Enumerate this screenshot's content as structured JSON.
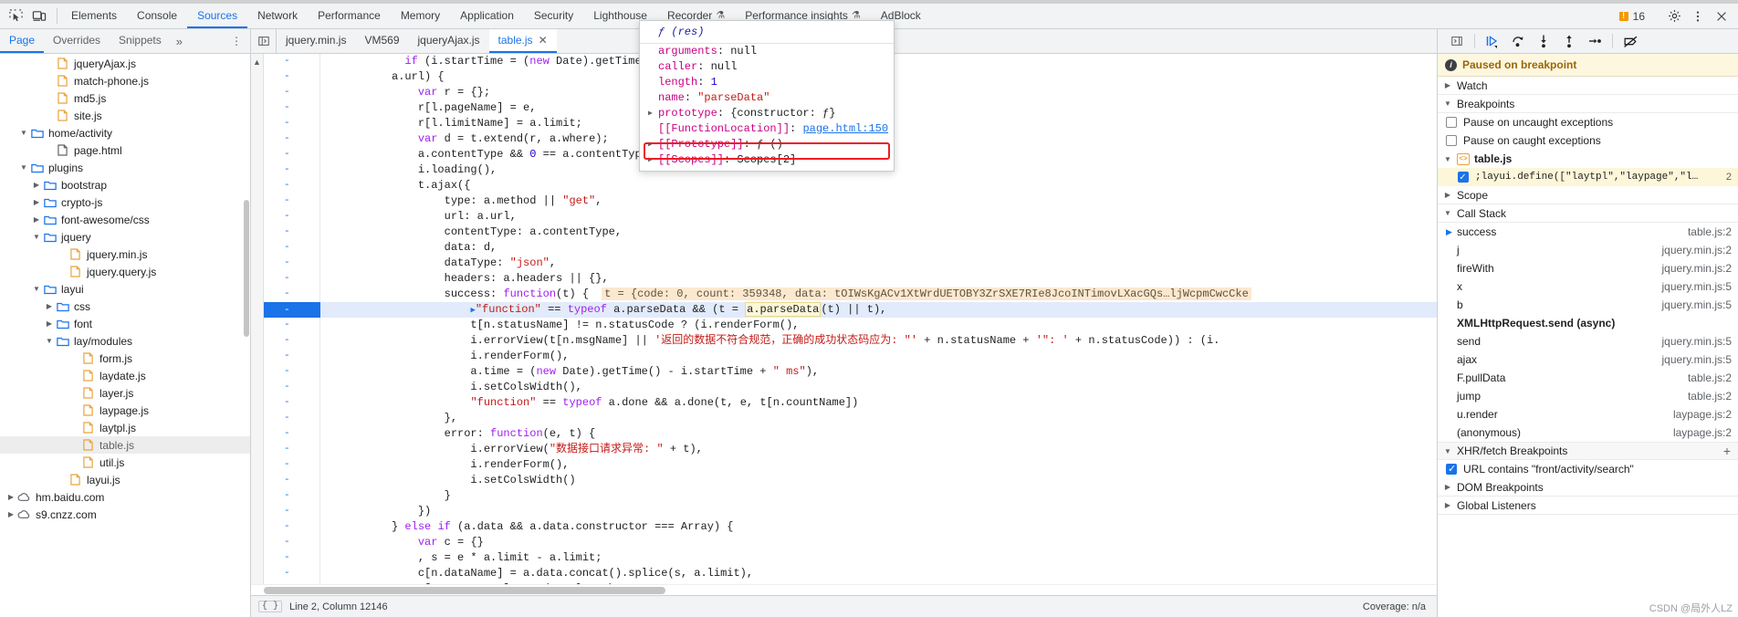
{
  "main_tabs": [
    {
      "label": "Elements",
      "active": false,
      "flask": false
    },
    {
      "label": "Console",
      "active": false,
      "flask": false
    },
    {
      "label": "Sources",
      "active": true,
      "flask": false
    },
    {
      "label": "Network",
      "active": false,
      "flask": false
    },
    {
      "label": "Performance",
      "active": false,
      "flask": false
    },
    {
      "label": "Memory",
      "active": false,
      "flask": false
    },
    {
      "label": "Application",
      "active": false,
      "flask": false
    },
    {
      "label": "Security",
      "active": false,
      "flask": false
    },
    {
      "label": "Lighthouse",
      "active": false,
      "flask": false
    },
    {
      "label": "Recorder",
      "active": false,
      "flask": true
    },
    {
      "label": "Performance insights",
      "active": false,
      "flask": true
    },
    {
      "label": "AdBlock",
      "active": false,
      "flask": false
    }
  ],
  "toolbar": {
    "inspect_icon": "inspect-element-icon",
    "device_icon": "device-toolbar-icon",
    "warning_count": "16",
    "settings_icon": "gear-icon",
    "more_icon": "more-vertical-icon",
    "close_icon": "close-icon"
  },
  "nav_tabs": [
    {
      "label": "Page",
      "active": true
    },
    {
      "label": "Overrides",
      "active": false
    },
    {
      "label": "Snippets",
      "active": false
    }
  ],
  "nav_more": "»",
  "nav_dots": "⋮",
  "editor_tabs": [
    {
      "label": "jquery.min.js",
      "active": false,
      "closable": false
    },
    {
      "label": "VM569",
      "active": false,
      "closable": false
    },
    {
      "label": "jqueryAjax.js",
      "active": false,
      "closable": false
    },
    {
      "label": "table.js",
      "active": true,
      "closable": true
    }
  ],
  "debugger_buttons": [
    {
      "name": "resume-script-button",
      "glyph": "▶"
    },
    {
      "name": "step-over-button",
      "glyph": "↷"
    },
    {
      "name": "step-into-button",
      "glyph": "↓"
    },
    {
      "name": "step-out-button",
      "glyph": "↑"
    },
    {
      "name": "step-button",
      "glyph": "→"
    },
    {
      "name": "deactivate-breakpoints-button",
      "glyph": "⊘"
    }
  ],
  "file_tree": [
    {
      "label": "jqueryAjax.js",
      "indent": 3,
      "type": "js",
      "twisty": "",
      "selected": false
    },
    {
      "label": "match-phone.js",
      "indent": 3,
      "type": "js",
      "twisty": "",
      "selected": false
    },
    {
      "label": "md5.js",
      "indent": 3,
      "type": "js",
      "twisty": "",
      "selected": false
    },
    {
      "label": "site.js",
      "indent": 3,
      "type": "js",
      "twisty": "",
      "selected": false
    },
    {
      "label": "home/activity",
      "indent": 1,
      "type": "folder",
      "twisty": "▼",
      "selected": false
    },
    {
      "label": "page.html",
      "indent": 3,
      "type": "html",
      "twisty": "",
      "selected": false
    },
    {
      "label": "plugins",
      "indent": 1,
      "type": "folder",
      "twisty": "▼",
      "selected": false
    },
    {
      "label": "bootstrap",
      "indent": 2,
      "type": "folder",
      "twisty": "▶",
      "selected": false
    },
    {
      "label": "crypto-js",
      "indent": 2,
      "type": "folder",
      "twisty": "▶",
      "selected": false
    },
    {
      "label": "font-awesome/css",
      "indent": 2,
      "type": "folder",
      "twisty": "▶",
      "selected": false
    },
    {
      "label": "jquery",
      "indent": 2,
      "type": "folder",
      "twisty": "▼",
      "selected": false
    },
    {
      "label": "jquery.min.js",
      "indent": 4,
      "type": "js",
      "twisty": "",
      "selected": false
    },
    {
      "label": "jquery.query.js",
      "indent": 4,
      "type": "js",
      "twisty": "",
      "selected": false
    },
    {
      "label": "layui",
      "indent": 2,
      "type": "folder",
      "twisty": "▼",
      "selected": false
    },
    {
      "label": "css",
      "indent": 3,
      "type": "folder",
      "twisty": "▶",
      "selected": false
    },
    {
      "label": "font",
      "indent": 3,
      "type": "folder",
      "twisty": "▶",
      "selected": false
    },
    {
      "label": "lay/modules",
      "indent": 3,
      "type": "folder",
      "twisty": "▼",
      "selected": false
    },
    {
      "label": "form.js",
      "indent": 5,
      "type": "js",
      "twisty": "",
      "selected": false
    },
    {
      "label": "laydate.js",
      "indent": 5,
      "type": "js",
      "twisty": "",
      "selected": false
    },
    {
      "label": "layer.js",
      "indent": 5,
      "type": "js",
      "twisty": "",
      "selected": false
    },
    {
      "label": "laypage.js",
      "indent": 5,
      "type": "js",
      "twisty": "",
      "selected": false
    },
    {
      "label": "laytpl.js",
      "indent": 5,
      "type": "js",
      "twisty": "",
      "selected": false
    },
    {
      "label": "table.js",
      "indent": 5,
      "type": "js",
      "twisty": "",
      "selected": true
    },
    {
      "label": "util.js",
      "indent": 5,
      "type": "js",
      "twisty": "",
      "selected": false
    },
    {
      "label": "layui.js",
      "indent": 4,
      "type": "js",
      "twisty": "",
      "selected": false
    },
    {
      "label": "hm.baidu.com",
      "indent": 0,
      "type": "cloud",
      "twisty": "▶",
      "selected": false
    },
    {
      "label": "s9.cnzz.com",
      "indent": 0,
      "type": "cloud",
      "twisty": "▶",
      "selected": false
    }
  ],
  "code_lines": [
    {
      "indent": 6,
      "text": "if (i.startTime = (new Date).getTime(),",
      "hl": false
    },
    {
      "indent": 5,
      "text": "a.url) {",
      "hl": false
    },
    {
      "indent": 7,
      "text": "var r = {};",
      "hl": false
    },
    {
      "indent": 7,
      "text": "r[l.pageName] = e,",
      "hl": false
    },
    {
      "indent": 7,
      "text": "r[l.limitName] = a.limit;",
      "hl": false
    },
    {
      "indent": 7,
      "text": "var d = t.extend(r, a.where);",
      "hl": false
    },
    {
      "indent": 7,
      "text": "a.contentType && 0 == a.contentType.indexOf(\"appl",
      "hl": false
    },
    {
      "indent": 7,
      "text": "i.loading(),",
      "hl": false
    },
    {
      "indent": 7,
      "text": "t.ajax({",
      "hl": false
    },
    {
      "indent": 9,
      "text": "type: a.method || \"get\",",
      "hl": false
    },
    {
      "indent": 9,
      "text": "url: a.url,",
      "hl": false
    },
    {
      "indent": 9,
      "text": "contentType: a.contentType,",
      "hl": false
    },
    {
      "indent": 9,
      "text": "data: d,",
      "hl": false
    },
    {
      "indent": 9,
      "text": "dataType: \"json\",",
      "hl": false
    },
    {
      "indent": 9,
      "text": "headers: a.headers || {},",
      "hl": false
    },
    {
      "indent": 9,
      "text": "success: function(t) {",
      "hl": false
    },
    {
      "indent": 11,
      "text": "\"function\" == typeof a.parseData && (t = a.parseData(t) || t),",
      "hl": true
    },
    {
      "indent": 11,
      "text": "t[n.statusName] != n.statusCode ? (i.renderForm(),",
      "hl": false
    },
    {
      "indent": 11,
      "text": "i.errorView(t[n.msgName] || '返回的数据不符合规范，正确的成功状态码应为: \"' + n.statusName + '\": ' + n.statusCode)) : (i.",
      "hl": false
    },
    {
      "indent": 11,
      "text": "i.renderForm(),",
      "hl": false
    },
    {
      "indent": 11,
      "text": "a.time = (new Date).getTime() - i.startTime + \" ms\"),",
      "hl": false
    },
    {
      "indent": 11,
      "text": "i.setColsWidth(),",
      "hl": false
    },
    {
      "indent": 11,
      "text": "\"function\" == typeof a.done && a.done(t, e, t[n.countName])",
      "hl": false
    },
    {
      "indent": 9,
      "text": "},",
      "hl": false
    },
    {
      "indent": 9,
      "text": "error: function(e, t) {",
      "hl": false
    },
    {
      "indent": 11,
      "text": "i.errorView(\"数据接口请求异常: \" + t),",
      "hl": false
    },
    {
      "indent": 11,
      "text": "i.renderForm(),",
      "hl": false
    },
    {
      "indent": 11,
      "text": "i.setColsWidth()",
      "hl": false
    },
    {
      "indent": 9,
      "text": "}",
      "hl": false
    },
    {
      "indent": 7,
      "text": "})",
      "hl": false
    },
    {
      "indent": 5,
      "text": "} else if (a.data && a.data.constructor === Array) {",
      "hl": false
    },
    {
      "indent": 7,
      "text": "var c = {}",
      "hl": false
    },
    {
      "indent": 7,
      "text": ", s = e * a.limit - a.limit;",
      "hl": false
    },
    {
      "indent": 7,
      "text": "c[n.dataName] = a.data.concat().splice(s, a.limit),",
      "hl": false
    },
    {
      "indent": 7,
      "text": "c[n.countName] = a.data.length",
      "hl": false
    }
  ],
  "inline_eval": "t = {code: 0, count: 359348, data: tOIWsKgACv1XtWrdUETOBY3ZrSXE7RIe8JcoINTimovLXacGQs…ljWcpmCwcCke",
  "exec_line": {
    "prefix": "\"function\" == typeof a.parseData && (t = ",
    "object_text": "a.parseData",
    "suffix": "(t) || t),"
  },
  "popup": {
    "title": "ƒ (res)",
    "rows": [
      {
        "key": "arguments",
        "value": "null",
        "kind": "plain",
        "twisty": false
      },
      {
        "key": "caller",
        "value": "null",
        "kind": "plain",
        "twisty": false
      },
      {
        "key": "length",
        "value": "1",
        "kind": "num",
        "twisty": false
      },
      {
        "key": "name",
        "value": "\"parseData\"",
        "kind": "str",
        "twisty": false
      },
      {
        "key": "prototype",
        "value": "{constructor: ƒ}",
        "kind": "plain",
        "twisty": true
      },
      {
        "key": "[[FunctionLocation]]",
        "value": "page.html:150",
        "kind": "link",
        "twisty": false,
        "highlighted": true
      },
      {
        "key": "[[Prototype]]",
        "value": "ƒ ()",
        "kind": "plain",
        "twisty": true
      },
      {
        "key": "[[Scopes]]",
        "value": "Scopes[2]",
        "kind": "plain",
        "twisty": true
      }
    ]
  },
  "status_bar": {
    "icon": "format-braces-icon",
    "position": "Line 2, Column 12146",
    "coverage": "Coverage: n/a"
  },
  "debugger_panel": {
    "paused_banner": "Paused on breakpoint",
    "watch_label": "Watch",
    "breakpoints_label": "Breakpoints",
    "pause_uncaught_label": "Pause on uncaught exceptions",
    "pause_uncaught_checked": false,
    "pause_caught_label": "Pause on caught exceptions",
    "pause_caught_checked": false,
    "bp_file": "table.js",
    "bp_entry": ";layui.define([\"laytpl\",\"laypage\",\"layer\",\"form…",
    "bp_entry_line": "2",
    "scope_label": "Scope",
    "call_stack_label": "Call Stack",
    "call_stack": [
      {
        "fn": "success",
        "loc": "table.js:2",
        "current": true,
        "async": false
      },
      {
        "fn": "j",
        "loc": "jquery.min.js:2",
        "current": false,
        "async": false
      },
      {
        "fn": "fireWith",
        "loc": "jquery.min.js:2",
        "current": false,
        "async": false
      },
      {
        "fn": "x",
        "loc": "jquery.min.js:5",
        "current": false,
        "async": false
      },
      {
        "fn": "b",
        "loc": "jquery.min.js:5",
        "current": false,
        "async": false
      },
      {
        "fn": "XMLHttpRequest.send (async)",
        "loc": "",
        "current": false,
        "async": true
      },
      {
        "fn": "send",
        "loc": "jquery.min.js:5",
        "current": false,
        "async": false
      },
      {
        "fn": "ajax",
        "loc": "jquery.min.js:5",
        "current": false,
        "async": false
      },
      {
        "fn": "F.pullData",
        "loc": "table.js:2",
        "current": false,
        "async": false
      },
      {
        "fn": "jump",
        "loc": "table.js:2",
        "current": false,
        "async": false
      },
      {
        "fn": "u.render",
        "loc": "laypage.js:2",
        "current": false,
        "async": false
      },
      {
        "fn": "(anonymous)",
        "loc": "laypage.js:2",
        "current": false,
        "async": false
      }
    ],
    "xhr_label": "XHR/fetch Breakpoints",
    "xhr_add": "+",
    "xhr_item": "URL contains \"front/activity/search\"",
    "xhr_item_checked": true,
    "dom_label": "DOM Breakpoints",
    "global_label": "Global Listeners"
  },
  "watermark": "CSDN @局外人LZ"
}
